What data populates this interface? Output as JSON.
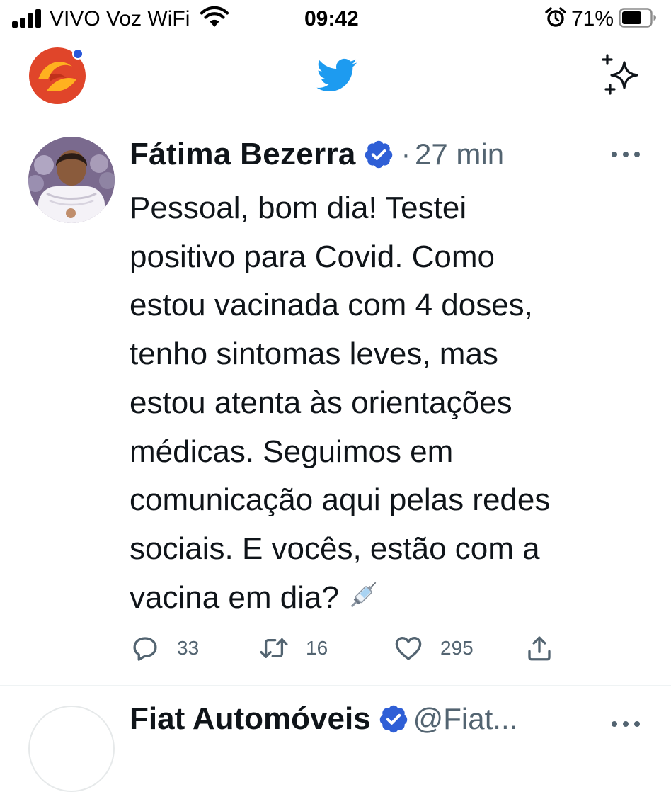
{
  "status_bar": {
    "carrier": "VIVO Voz WiFi",
    "time": "09:42",
    "battery_percent": "71%",
    "battery_level": 0.71
  },
  "header": {
    "logo_icon": "twitter-bird-icon",
    "sparkle_icon": "sparkle-icon"
  },
  "tweet": {
    "author_name": "Fátima Bezerra",
    "verified": true,
    "separator": "·",
    "timestamp": "27 min",
    "text": "Pessoal, bom dia! Testei positivo para Covid. Como estou vacinada com 4 doses, tenho sintomas leves, mas estou atenta às orientações médicas. Seguimos em comunicação aqui pelas redes sociais. E vocês, estão com a vacina em dia?",
    "text_lines": [
      "Pessoal, bom dia! Testei",
      "positivo para Covid. Como",
      "estou vacinada com 4 doses,",
      "tenho sintomas leves, mas",
      "estou atenta às orientações",
      "médicas. Seguimos em",
      "comunicação aqui pelas redes",
      "sociais. E vocês, estão com a",
      "vacina em dia?"
    ],
    "emoji": "syringe-icon",
    "replies": "33",
    "retweets": "16",
    "likes": "295"
  },
  "next_tweet": {
    "author_name": "Fiat Automóveis",
    "handle": "@Fiat..."
  },
  "colors": {
    "twitter_blue": "#1d9bf0",
    "verified_blue": "#2f5fd6",
    "text_primary": "#0f1419",
    "text_secondary": "#536471"
  }
}
